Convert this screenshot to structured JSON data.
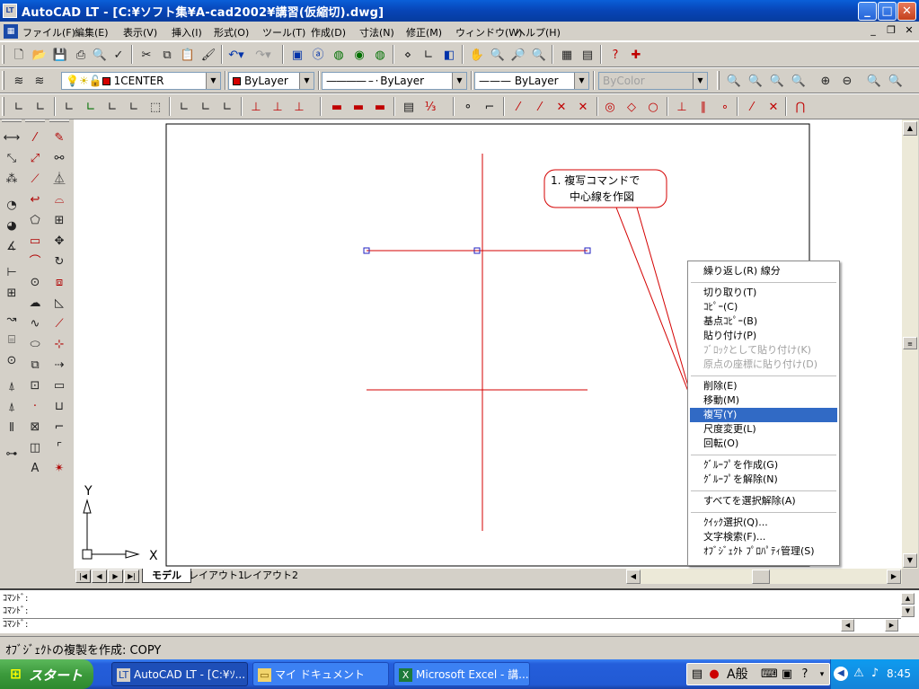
{
  "window": {
    "title": "AutoCAD LT - [C:¥ソフト集¥A-cad2002¥講習(仮縮切).dwg]",
    "app_icon": "LT"
  },
  "menubar": {
    "items": [
      "ファイル(F)",
      "編集(E)",
      "表示(V)",
      "挿入(I)",
      "形式(O)",
      "ツール(T)",
      "作成(D)",
      "寸法(N)",
      "修正(M)",
      "ウィンドウ(W)",
      "ヘルプ(H)"
    ]
  },
  "layer": {
    "current": "1CENTER"
  },
  "properties": {
    "color": "ByLayer",
    "linetype": "ByLayer",
    "lineweight": "ByLayer",
    "plotstyle": "ByColor"
  },
  "colors": {
    "center_line": "#d40000",
    "line": "#c00000",
    "highlight": "#316ac5",
    "title_bar": "#0a5fd8",
    "taskbar": "#245edb",
    "start_button": "#3c9a3c"
  },
  "canvas": {
    "callout_text": [
      "1. 複写コマンドで",
      "中心線を作図"
    ],
    "ucs_x_label": "X",
    "ucs_y_label": "Y"
  },
  "layout_tabs": [
    "モデル",
    "レイアウト1",
    "レイアウト2"
  ],
  "context_menu": {
    "groups": [
      [
        {
          "label": "繰り返し(R) 線分",
          "state": "normal"
        }
      ],
      [
        {
          "label": "切り取り(T)",
          "state": "normal"
        },
        {
          "label": "ｺﾋﾟｰ(C)",
          "state": "normal"
        },
        {
          "label": "基点ｺﾋﾟｰ(B)",
          "state": "normal"
        },
        {
          "label": "貼り付け(P)",
          "state": "normal"
        },
        {
          "label": "ﾌﾞﾛｯｸとして貼り付け(K)",
          "state": "disabled"
        },
        {
          "label": "原点の座標に貼り付け(D)",
          "state": "disabled"
        }
      ],
      [
        {
          "label": "削除(E)",
          "state": "normal"
        },
        {
          "label": "移動(M)",
          "state": "normal"
        },
        {
          "label": "複写(Y)",
          "state": "highlighted"
        },
        {
          "label": "尺度変更(L)",
          "state": "normal"
        },
        {
          "label": "回転(O)",
          "state": "normal"
        }
      ],
      [
        {
          "label": "ｸﾞﾙｰﾌﾟを作成(G)",
          "state": "normal"
        },
        {
          "label": "ｸﾞﾙｰﾌﾟを解除(N)",
          "state": "normal"
        }
      ],
      [
        {
          "label": "すべてを選択解除(A)",
          "state": "normal"
        }
      ],
      [
        {
          "label": "ｸｲｯｸ選択(Q)...",
          "state": "normal"
        },
        {
          "label": "文字検索(F)...",
          "state": "normal"
        },
        {
          "label": "ｵﾌﾞｼﾞｪｸﾄ ﾌﾟﾛﾊﾟﾃｨ管理(S)",
          "state": "normal"
        }
      ]
    ]
  },
  "command_lines": [
    "ｺﾏﾝﾄﾞ:",
    "ｺﾏﾝﾄﾞ:",
    "ｺﾏﾝﾄﾞ:"
  ],
  "status": {
    "text": "ｵﾌﾞｼﾞｪｸﾄの複製を作成:  COPY"
  },
  "taskbar": {
    "start_label": "スタート",
    "tasks": [
      {
        "label": "AutoCAD LT - [C:¥ｿ...",
        "icon": "autocad-icon",
        "active": true
      },
      {
        "label": "マイ ドキュメント",
        "icon": "folder-icon",
        "active": false
      },
      {
        "label": "Microsoft Excel - 講...",
        "icon": "excel-icon",
        "active": false
      }
    ],
    "ime_mode": "A般",
    "clock": "8:45"
  }
}
